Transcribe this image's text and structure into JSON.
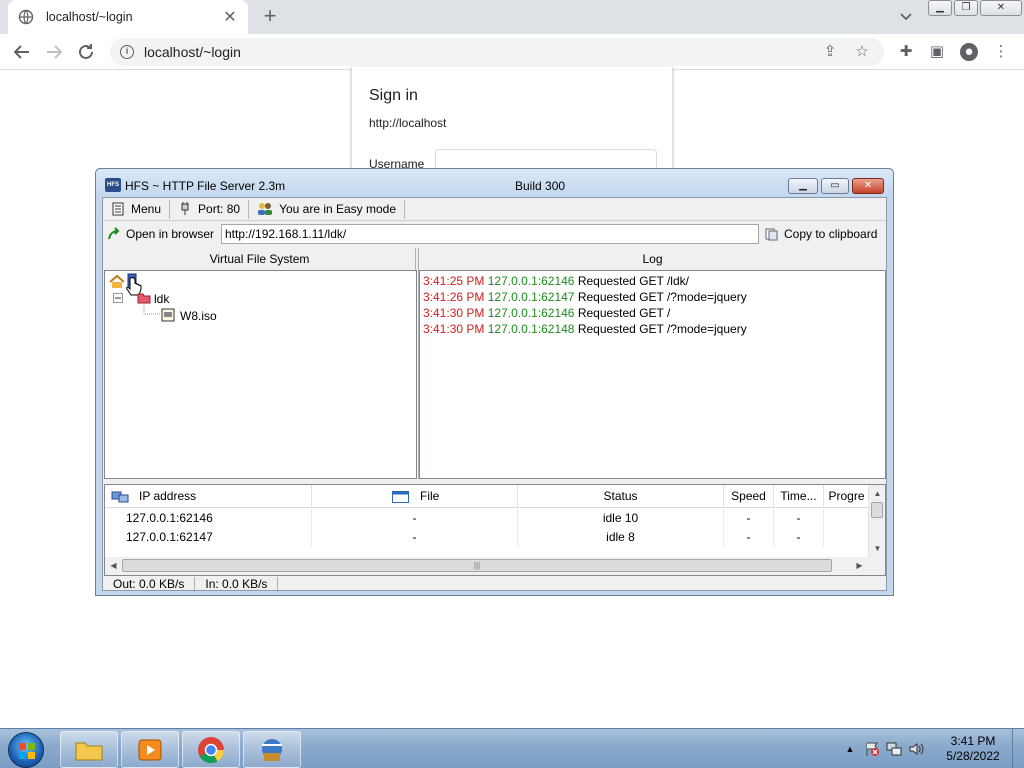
{
  "browser": {
    "tab_title": "localhost/~login",
    "new_tab_glyph": "+",
    "address": "localhost/~login",
    "icons": [
      "globe-icon",
      "close-icon",
      "back-icon",
      "forward-icon",
      "reload-icon",
      "info-icon",
      "share-icon",
      "star-icon",
      "extensions-icon",
      "sidepanel-icon",
      "profile-icon",
      "kebab-menu-icon"
    ]
  },
  "signin": {
    "heading": "Sign in",
    "host": "http://localhost",
    "username_label": "Username"
  },
  "hfs": {
    "title": "HFS ~ HTTP File Server 2.3m",
    "build": "Build 300",
    "menubar": {
      "menu": "Menu",
      "port": "Port: 80",
      "mode": "You are in Easy mode"
    },
    "open_in_browser": "Open in browser",
    "url": "http://192.168.1.11/ldk/",
    "copy_to_clipboard": "Copy to clipboard",
    "vfs_header": "Virtual File System",
    "log_header": "Log",
    "tree": {
      "folder": "ldk",
      "file": "W8.iso"
    },
    "log": [
      {
        "time": "3:41:25 PM",
        "ip": "127.0.0.1:62146",
        "msg": "Requested GET /ldk/"
      },
      {
        "time": "3:41:26 PM",
        "ip": "127.0.0.1:62147",
        "msg": "Requested GET /?mode=jquery"
      },
      {
        "time": "3:41:30 PM",
        "ip": "127.0.0.1:62146",
        "msg": "Requested GET /"
      },
      {
        "time": "3:41:30 PM",
        "ip": "127.0.0.1:62148",
        "msg": "Requested GET /?mode=jquery"
      }
    ],
    "connections": {
      "columns": [
        "IP address",
        "File",
        "Status",
        "Speed",
        "Time...",
        "Progre"
      ],
      "rows": [
        {
          "ip": "127.0.0.1:62146",
          "file": "-",
          "status": "idle 10",
          "speed": "-",
          "time": "-",
          "progress": ""
        },
        {
          "ip": "127.0.0.1:62147",
          "file": "-",
          "status": "idle 8",
          "speed": "-",
          "time": "-",
          "progress": ""
        }
      ]
    },
    "status": {
      "out": "Out: 0.0 KB/s",
      "in": "In: 0.0 KB/s"
    }
  },
  "taskbar": {
    "clock_time": "3:41 PM",
    "clock_date": "5/28/2022"
  }
}
